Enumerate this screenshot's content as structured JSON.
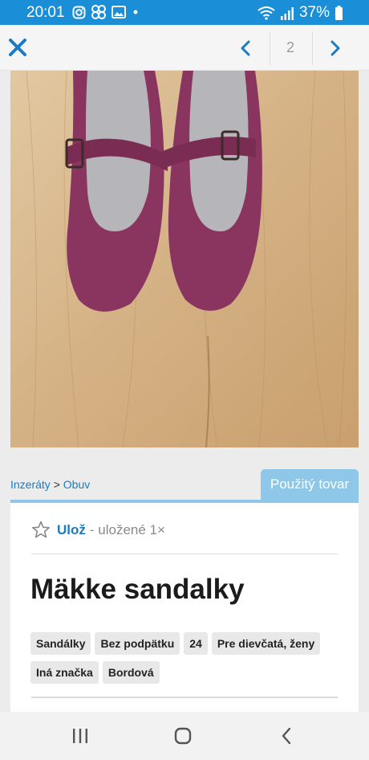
{
  "status_bar": {
    "time": "20:01",
    "battery": "37%",
    "icons_left": [
      "instagram-icon",
      "pinwheel-icon",
      "image-icon",
      "dot-icon"
    ],
    "icons_right": [
      "wifi-icon",
      "signal-icon",
      "battery-icon"
    ]
  },
  "nav": {
    "page_number": "2",
    "close_icon": "close-icon",
    "prev_icon": "chevron-left-icon",
    "next_icon": "chevron-right-icon",
    "accent": "#1a7bc2"
  },
  "breadcrumb": {
    "items": [
      "Inzeráty",
      "Obuv"
    ],
    "separator": ">"
  },
  "badge": {
    "label": "Použitý tovar",
    "color": "#8ec7e8"
  },
  "listing": {
    "save_label": "Ulož",
    "saved_text": "- uložené 1×",
    "title": "Mäkke sandalky",
    "tags": [
      "Sandálky",
      "Bez podpätku",
      "24",
      "Pre dievčatá, ženy",
      "Iná značka",
      "Bordová"
    ]
  },
  "system_nav": {
    "icons": [
      "recent-apps-icon",
      "home-icon",
      "back-icon"
    ]
  }
}
